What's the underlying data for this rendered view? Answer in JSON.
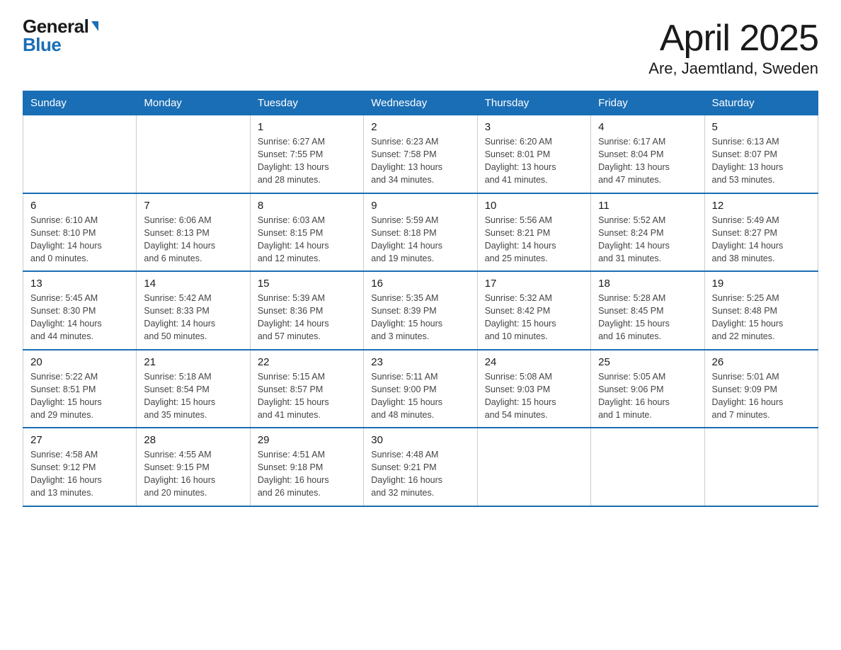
{
  "logo": {
    "general": "General",
    "blue": "Blue"
  },
  "title": "April 2025",
  "subtitle": "Are, Jaemtland, Sweden",
  "days_of_week": [
    "Sunday",
    "Monday",
    "Tuesday",
    "Wednesday",
    "Thursday",
    "Friday",
    "Saturday"
  ],
  "weeks": [
    [
      {
        "day": "",
        "info": ""
      },
      {
        "day": "",
        "info": ""
      },
      {
        "day": "1",
        "info": "Sunrise: 6:27 AM\nSunset: 7:55 PM\nDaylight: 13 hours\nand 28 minutes."
      },
      {
        "day": "2",
        "info": "Sunrise: 6:23 AM\nSunset: 7:58 PM\nDaylight: 13 hours\nand 34 minutes."
      },
      {
        "day": "3",
        "info": "Sunrise: 6:20 AM\nSunset: 8:01 PM\nDaylight: 13 hours\nand 41 minutes."
      },
      {
        "day": "4",
        "info": "Sunrise: 6:17 AM\nSunset: 8:04 PM\nDaylight: 13 hours\nand 47 minutes."
      },
      {
        "day": "5",
        "info": "Sunrise: 6:13 AM\nSunset: 8:07 PM\nDaylight: 13 hours\nand 53 minutes."
      }
    ],
    [
      {
        "day": "6",
        "info": "Sunrise: 6:10 AM\nSunset: 8:10 PM\nDaylight: 14 hours\nand 0 minutes."
      },
      {
        "day": "7",
        "info": "Sunrise: 6:06 AM\nSunset: 8:13 PM\nDaylight: 14 hours\nand 6 minutes."
      },
      {
        "day": "8",
        "info": "Sunrise: 6:03 AM\nSunset: 8:15 PM\nDaylight: 14 hours\nand 12 minutes."
      },
      {
        "day": "9",
        "info": "Sunrise: 5:59 AM\nSunset: 8:18 PM\nDaylight: 14 hours\nand 19 minutes."
      },
      {
        "day": "10",
        "info": "Sunrise: 5:56 AM\nSunset: 8:21 PM\nDaylight: 14 hours\nand 25 minutes."
      },
      {
        "day": "11",
        "info": "Sunrise: 5:52 AM\nSunset: 8:24 PM\nDaylight: 14 hours\nand 31 minutes."
      },
      {
        "day": "12",
        "info": "Sunrise: 5:49 AM\nSunset: 8:27 PM\nDaylight: 14 hours\nand 38 minutes."
      }
    ],
    [
      {
        "day": "13",
        "info": "Sunrise: 5:45 AM\nSunset: 8:30 PM\nDaylight: 14 hours\nand 44 minutes."
      },
      {
        "day": "14",
        "info": "Sunrise: 5:42 AM\nSunset: 8:33 PM\nDaylight: 14 hours\nand 50 minutes."
      },
      {
        "day": "15",
        "info": "Sunrise: 5:39 AM\nSunset: 8:36 PM\nDaylight: 14 hours\nand 57 minutes."
      },
      {
        "day": "16",
        "info": "Sunrise: 5:35 AM\nSunset: 8:39 PM\nDaylight: 15 hours\nand 3 minutes."
      },
      {
        "day": "17",
        "info": "Sunrise: 5:32 AM\nSunset: 8:42 PM\nDaylight: 15 hours\nand 10 minutes."
      },
      {
        "day": "18",
        "info": "Sunrise: 5:28 AM\nSunset: 8:45 PM\nDaylight: 15 hours\nand 16 minutes."
      },
      {
        "day": "19",
        "info": "Sunrise: 5:25 AM\nSunset: 8:48 PM\nDaylight: 15 hours\nand 22 minutes."
      }
    ],
    [
      {
        "day": "20",
        "info": "Sunrise: 5:22 AM\nSunset: 8:51 PM\nDaylight: 15 hours\nand 29 minutes."
      },
      {
        "day": "21",
        "info": "Sunrise: 5:18 AM\nSunset: 8:54 PM\nDaylight: 15 hours\nand 35 minutes."
      },
      {
        "day": "22",
        "info": "Sunrise: 5:15 AM\nSunset: 8:57 PM\nDaylight: 15 hours\nand 41 minutes."
      },
      {
        "day": "23",
        "info": "Sunrise: 5:11 AM\nSunset: 9:00 PM\nDaylight: 15 hours\nand 48 minutes."
      },
      {
        "day": "24",
        "info": "Sunrise: 5:08 AM\nSunset: 9:03 PM\nDaylight: 15 hours\nand 54 minutes."
      },
      {
        "day": "25",
        "info": "Sunrise: 5:05 AM\nSunset: 9:06 PM\nDaylight: 16 hours\nand 1 minute."
      },
      {
        "day": "26",
        "info": "Sunrise: 5:01 AM\nSunset: 9:09 PM\nDaylight: 16 hours\nand 7 minutes."
      }
    ],
    [
      {
        "day": "27",
        "info": "Sunrise: 4:58 AM\nSunset: 9:12 PM\nDaylight: 16 hours\nand 13 minutes."
      },
      {
        "day": "28",
        "info": "Sunrise: 4:55 AM\nSunset: 9:15 PM\nDaylight: 16 hours\nand 20 minutes."
      },
      {
        "day": "29",
        "info": "Sunrise: 4:51 AM\nSunset: 9:18 PM\nDaylight: 16 hours\nand 26 minutes."
      },
      {
        "day": "30",
        "info": "Sunrise: 4:48 AM\nSunset: 9:21 PM\nDaylight: 16 hours\nand 32 minutes."
      },
      {
        "day": "",
        "info": ""
      },
      {
        "day": "",
        "info": ""
      },
      {
        "day": "",
        "info": ""
      }
    ]
  ]
}
